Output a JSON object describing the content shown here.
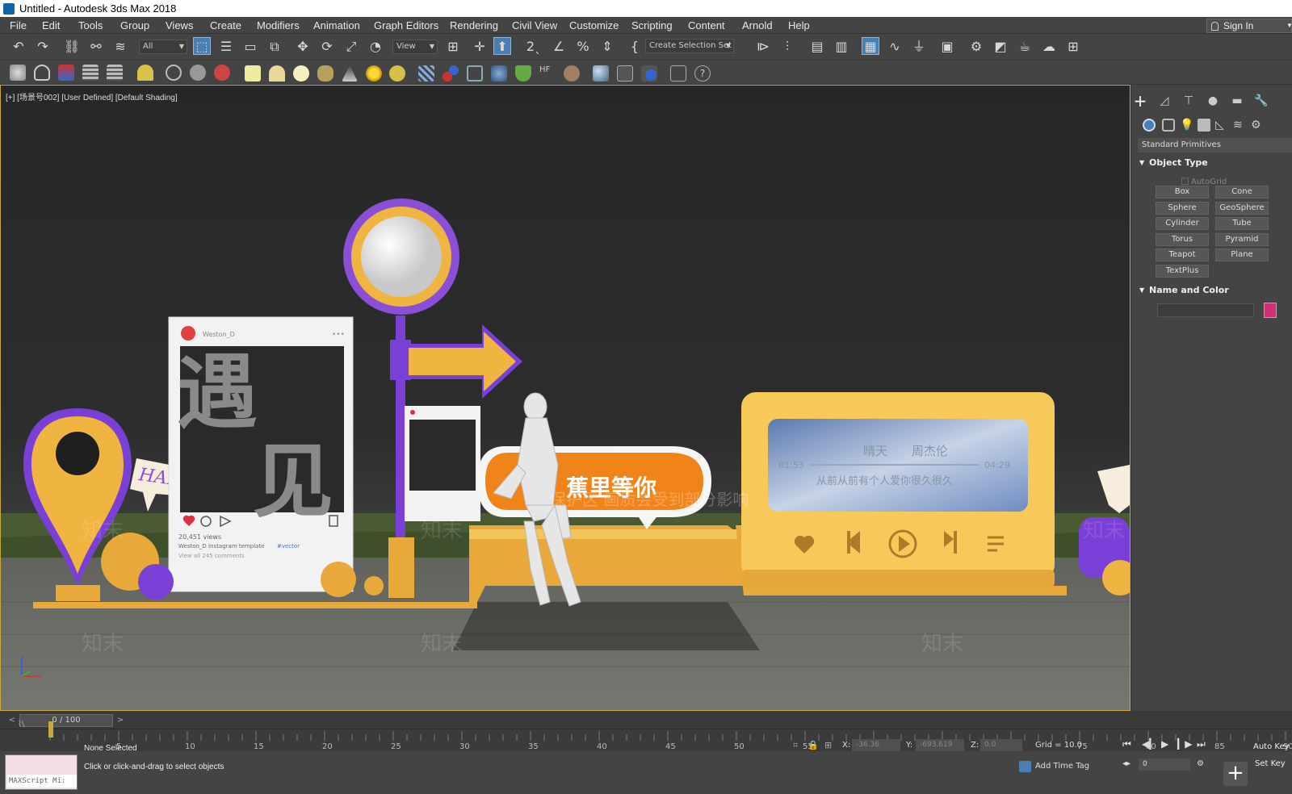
{
  "window": {
    "title": "Untitled - Autodesk 3ds Max 2018"
  },
  "menu": {
    "items": [
      "File",
      "Edit",
      "Tools",
      "Group",
      "Views",
      "Create",
      "Modifiers",
      "Animation",
      "Graph Editors",
      "Rendering",
      "Civil View",
      "Customize",
      "Scripting",
      "Content",
      "Arnold",
      "Help"
    ],
    "sign_in": "Sign In"
  },
  "toolbar": {
    "filter_value": "All",
    "ref_coord_value": "View",
    "selection_set_placeholder": "Create Selection Set"
  },
  "viewport": {
    "label": "[+] [场景号002] [User Defined] [Default Shading]",
    "scene_texts": {
      "big_chars_1": "遇",
      "big_chars_2": "见",
      "post_user": "Weston_D",
      "post_views": "20,451 views",
      "post_caption": "Weston_D Instagram template",
      "post_tag": "#vector",
      "post_comments": "View all 245 comments",
      "happy_sign": "HAPPY",
      "bubble_text": "蕉里等你",
      "watermark_text": "保护区 画质会受到部分影响",
      "song_title": "晴天",
      "song_artist": "周杰伦",
      "time_elapsed": "01:53",
      "time_total": "04:29",
      "lyric": "从前从前有个人爱你很久很久",
      "wm_brand": "知末"
    }
  },
  "command_panel": {
    "category": "Standard Primitives",
    "object_type_title": "Object Type",
    "autogrid_label": "AutoGrid",
    "buttons": [
      "Box",
      "Cone",
      "Sphere",
      "GeoSphere",
      "Cylinder",
      "Tube",
      "Torus",
      "Pyramid",
      "Teapot",
      "Plane",
      "TextPlus"
    ],
    "name_color_title": "Name and Color",
    "object_color": "#d0307a"
  },
  "timeline": {
    "slider_text": "0 / 100",
    "ticks": [
      "0",
      "5",
      "10",
      "15",
      "20",
      "25",
      "30",
      "35",
      "40",
      "45",
      "50",
      "55",
      "60",
      "65",
      "70",
      "75",
      "80",
      "85",
      "90"
    ]
  },
  "status": {
    "maxscript": "MAXScript Mi:",
    "selection": "None Selected",
    "prompt": "Click or click-and-drag to select objects",
    "x_label": "X:",
    "x_value": "-36.36",
    "y_label": "Y:",
    "y_value": "-693.619",
    "z_label": "Z:",
    "z_value": "0.0",
    "grid": "Grid = 10.0",
    "add_time_tag": "Add Time Tag",
    "auto_key": "Auto Key",
    "set_key": "Set Key",
    "frame_value": "0"
  }
}
